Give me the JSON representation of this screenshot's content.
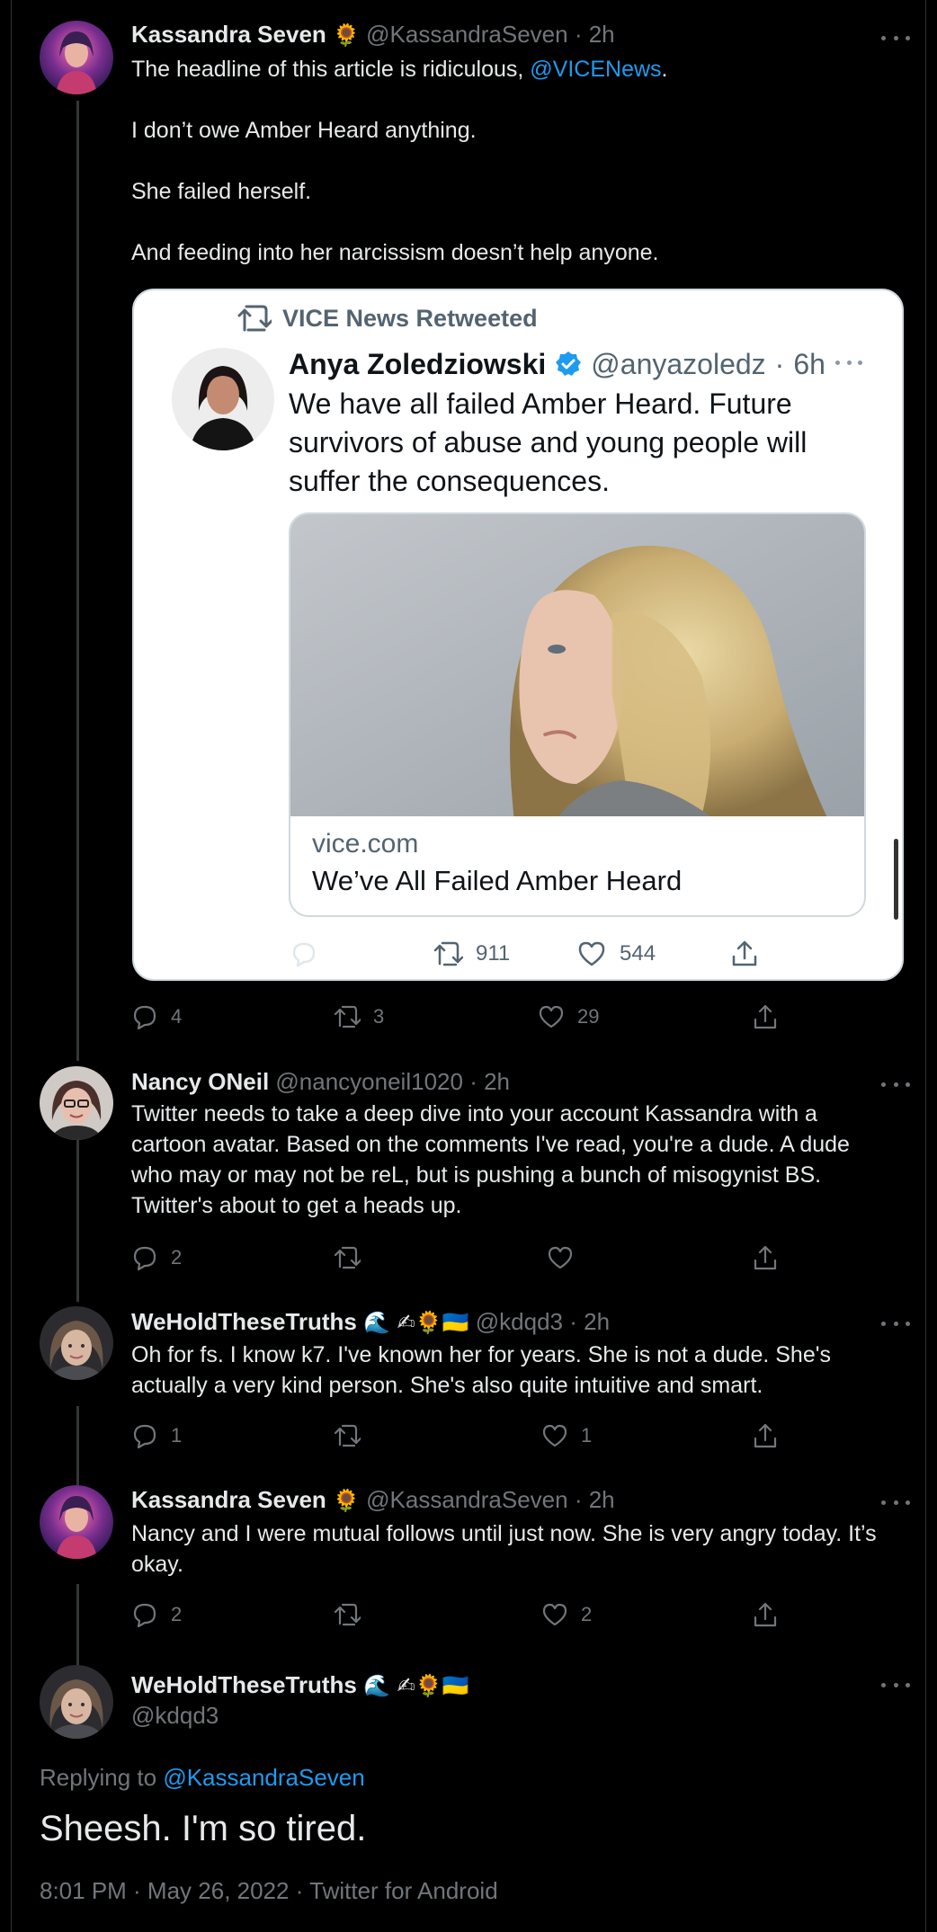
{
  "tweets": [
    {
      "name": "Kassandra Seven",
      "badge": "🌻",
      "handle": "@KassandraSeven",
      "time": "2h",
      "mention": "@VICENews",
      "text_before_mention": "The headline of this article is ridiculous, ",
      "text_after_mention": ".",
      "paragraphs": [
        "I don’t owe Amber Heard anything.",
        "She failed herself.",
        "And feeding into her narcissism doesn’t help anyone."
      ],
      "stats": {
        "replies": "4",
        "retweets": "3",
        "likes": "29"
      }
    },
    {
      "name": "Nancy ONeil",
      "handle": "@nancyoneil1020",
      "time": "2h",
      "text": "Twitter needs to take a deep dive into your account Kassandra with a cartoon avatar. Based on the comments I've read, you're a dude. A dude who may or may not be reL, but is pushing a bunch of misogynist BS. Twitter's about to get a heads up.",
      "stats": {
        "replies": "2",
        "retweets": "",
        "likes": ""
      }
    },
    {
      "name": "WeHoldTheseTruths",
      "badge": "🌊 ✍🌻🇺🇦",
      "handle": "@kdqd3",
      "time": "2h",
      "text": "Oh for fs. I know k7. I've known her for years. She is not a dude. She's actually a very kind person. She's also quite intuitive and smart.",
      "stats": {
        "replies": "1",
        "retweets": "",
        "likes": "1"
      }
    },
    {
      "name": "Kassandra Seven",
      "badge": "🌻",
      "handle": "@KassandraSeven",
      "time": "2h",
      "text": "Nancy and I were mutual follows until just now. She is very angry today. It’s okay.",
      "stats": {
        "replies": "2",
        "retweets": "",
        "likes": "2"
      }
    }
  ],
  "separator": "·",
  "quoted": {
    "retweet_label": "VICE News Retweeted",
    "name": "Anya Zoledziowski",
    "handle": "@anyazoledz",
    "time": "6h",
    "text": "We have all failed Amber Heard. Future survivors of abuse and young people will suffer the consequences.",
    "link_domain": "vice.com",
    "link_title": "We’ve All Failed Amber Heard",
    "stats": {
      "retweets": "911",
      "likes": "544"
    }
  },
  "final": {
    "name": "WeHoldTheseTruths",
    "badge": "🌊 ✍🌻🇺🇦",
    "handle": "@kdqd3",
    "replying_prefix": "Replying to ",
    "replying_to": "@KassandraSeven",
    "text": "Sheesh. I'm so tired.",
    "meta": "8:01 PM · May 26, 2022 · Twitter for Android"
  },
  "icons": {
    "reply": "reply-icon",
    "retweet": "retweet-icon",
    "like": "heart-icon",
    "share": "share-icon",
    "more": "more-icon",
    "verified": "verified-badge-icon"
  },
  "colors": {
    "background": "#000000",
    "text": "#e7e9ea",
    "muted": "#71767b",
    "link": "#1d9bf0",
    "thread_line": "#333639"
  }
}
